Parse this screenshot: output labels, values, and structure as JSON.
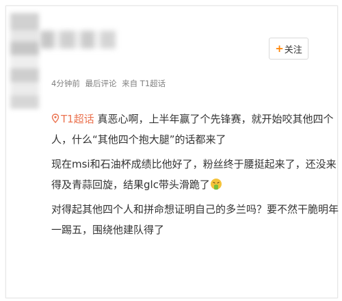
{
  "post": {
    "follow_label": "关注",
    "follow_plus": "+",
    "meta": {
      "time": "4分钟前",
      "label": "最后评论",
      "source": "来自 T1超话"
    },
    "topic_tag": "T1超话",
    "paragraphs": [
      " 真恶心啊，上半年赢了个先锋赛，就开始咬其他四个人，什么“其他四个抱大腿”的话都来了",
      "现在msi和石油杯成绩比他好了，粉丝终于腰挺起来了，还没来得及青蒜回旋，结果glc带头滑跪了",
      "对得起其他四个人和拼命想证明自己的多兰吗？要不然干脆明年一踢五，围绕他建队得了"
    ]
  },
  "colors": {
    "accent": "#ff8200",
    "topic": "#eb7350",
    "meta": "#808080"
  },
  "icons": [
    "location-pin-icon",
    "vomit-emoji-icon"
  ]
}
